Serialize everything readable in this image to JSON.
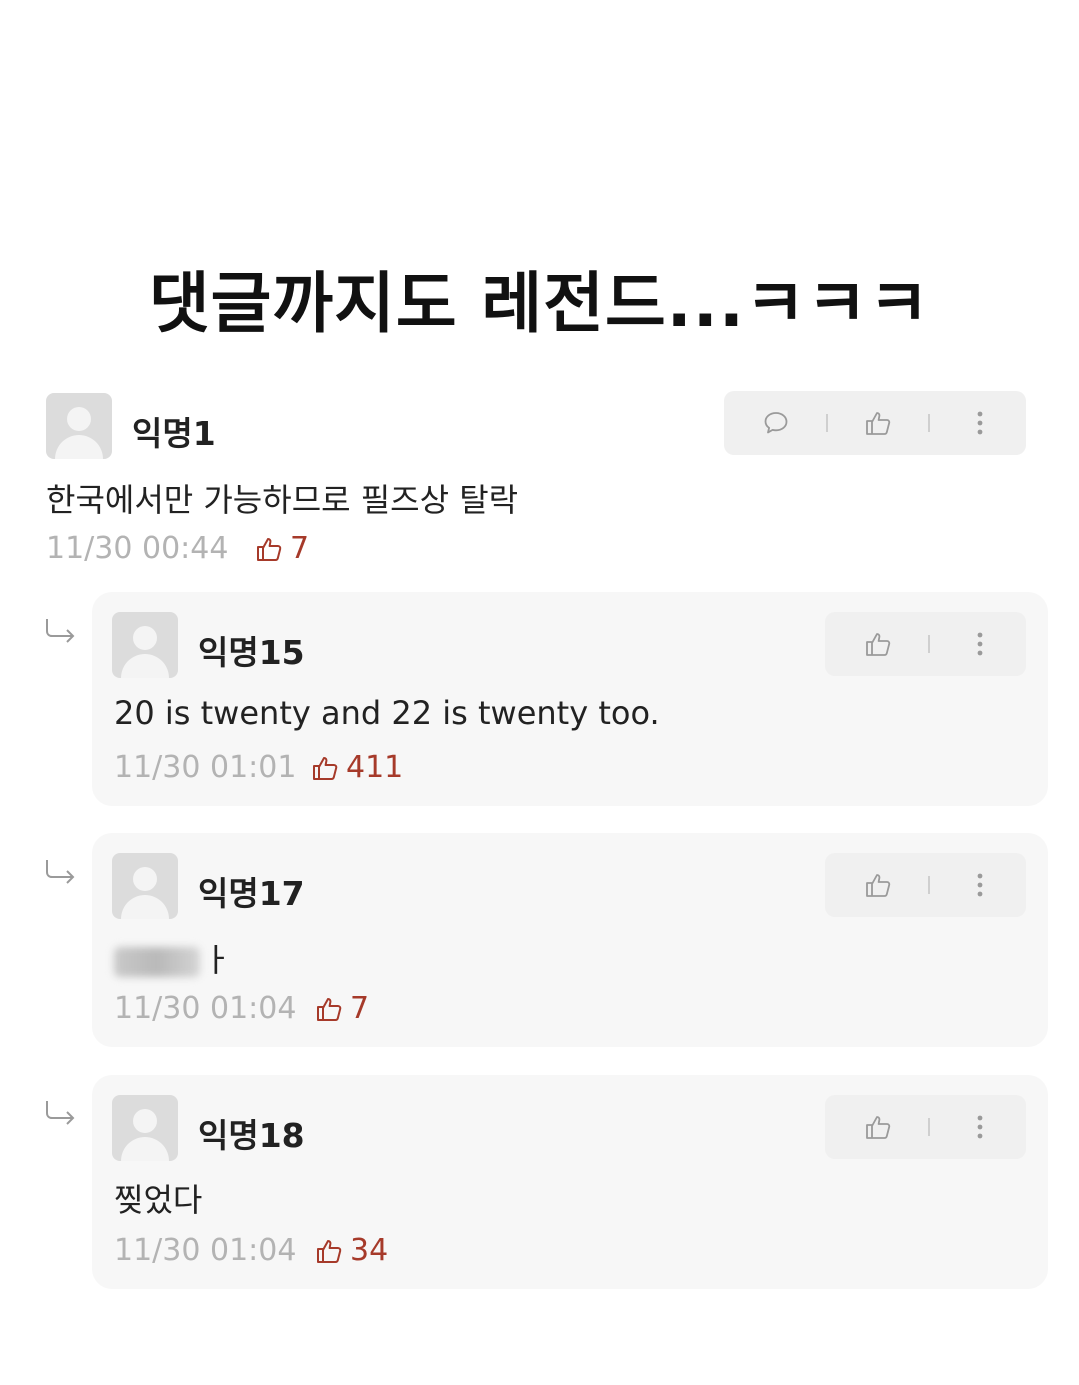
{
  "headline": "댓글까지도 레전드...ㅋㅋㅋ",
  "comments": [
    {
      "name": "익명1",
      "text": "한국에서만 가능하므로 필즈상 탈락",
      "time": "11/30 00:44",
      "likes": "7",
      "is_reply": false
    },
    {
      "name": "익명15",
      "text": "20 is twenty and 22 is twenty too.",
      "time": "11/30 01:01",
      "likes": "411",
      "is_reply": true
    },
    {
      "name": "익명17",
      "text": "ㅏ",
      "time": "11/30 01:04",
      "likes": "7",
      "is_reply": true
    },
    {
      "name": "익명18",
      "text": "찢었다",
      "time": "11/30 01:04",
      "likes": "34",
      "is_reply": true
    }
  ],
  "icons": {
    "comment": "speech-bubble-icon",
    "like": "thumbs-up-icon",
    "more": "vertical-dots-icon",
    "reply": "reply-arrow-icon",
    "avatar": "default-avatar-icon"
  },
  "colors": {
    "like_accent": "#a63a2a",
    "meta_gray": "#b3b3b3",
    "card_bg": "#f7f7f7"
  }
}
